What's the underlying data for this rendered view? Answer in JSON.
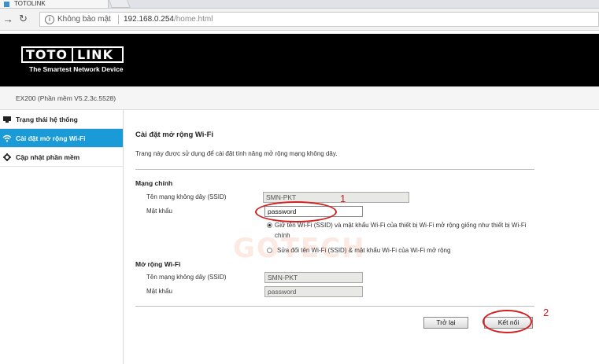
{
  "browser": {
    "tab_title": "TOTOLINK",
    "security_label": "Không bảo mật",
    "url_host": "192.168.0.254",
    "url_path": "/home.html"
  },
  "header": {
    "logo_left": "TOTO",
    "logo_right": "LINK",
    "tagline": "The Smartest Network Device"
  },
  "version_text": "EX200 (Phần mềm V5.2.3c.5528)",
  "sidebar": {
    "items": [
      {
        "label": "Trạng thái hệ thống",
        "icon": "monitor-icon"
      },
      {
        "label": "Cài đặt mở rộng Wi-Fi",
        "icon": "wifi-icon",
        "active": true
      },
      {
        "label": "Cập nhật phần mềm",
        "icon": "gear-icon"
      }
    ]
  },
  "main": {
    "title": "Cài đặt mở rộng Wi-Fi",
    "description": "Trang này được sử dụng để cài đặt tính năng mở rộng mạng không dây.",
    "primary_section": {
      "heading": "Mạng chính",
      "ssid_label": "Tên mạng không dây (SSID)",
      "ssid_value": "SMN-PKT",
      "password_label": "Mật khẩu",
      "password_value": "password"
    },
    "radio_options": [
      {
        "text": "Giữ tên Wi-Fi (SSID) và mật khẩu Wi-Fi của thiết bị Wi-Fi mở rộng giống như thiết bị Wi-Fi chính",
        "selected": true
      },
      {
        "text": "Sửa đổi tên Wi-Fi (SSID) & mật khẩu Wi-Fi của Wi-Fi mở rộng",
        "selected": false
      }
    ],
    "extended_section": {
      "heading": "Mở rộng Wi-Fi",
      "ssid_label": "Tên mạng không dây (SSID)",
      "ssid_value": "SMN-PKT",
      "password_label": "Mật khẩu",
      "password_value": "password"
    },
    "back_button": "Trở lại",
    "connect_button": "Kết nối"
  },
  "annotations": {
    "step1": "1",
    "step2": "2"
  },
  "watermark": "GOTECH",
  "colors": {
    "accent": "#1a9ad6",
    "annotation": "#d42020",
    "header_bg": "#000000"
  }
}
